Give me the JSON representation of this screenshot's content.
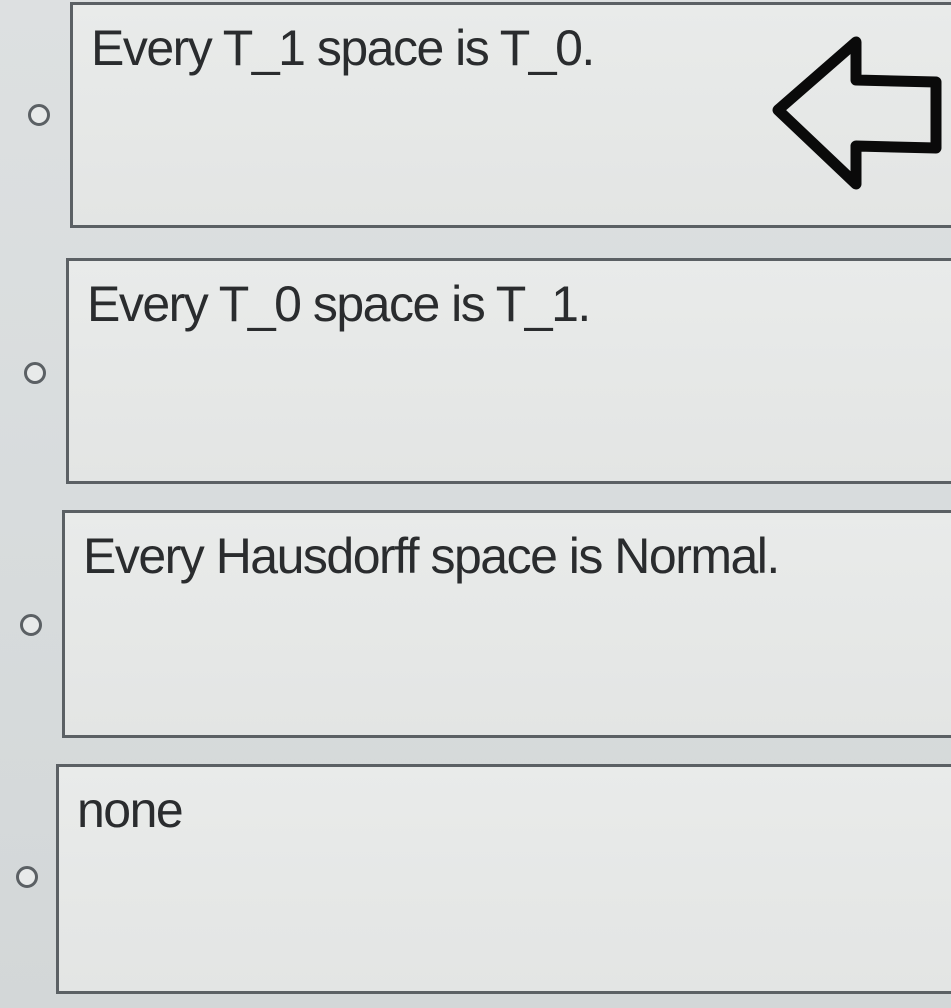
{
  "question": {
    "options": [
      {
        "label": "Every T_1 space is T_0."
      },
      {
        "label": "Every T_0 space is T_1."
      },
      {
        "label": "Every Hausdorff space is Normal."
      },
      {
        "label": "none"
      }
    ]
  },
  "annotation": {
    "icon": "left-arrow-icon",
    "color": "#0a0a0a"
  }
}
